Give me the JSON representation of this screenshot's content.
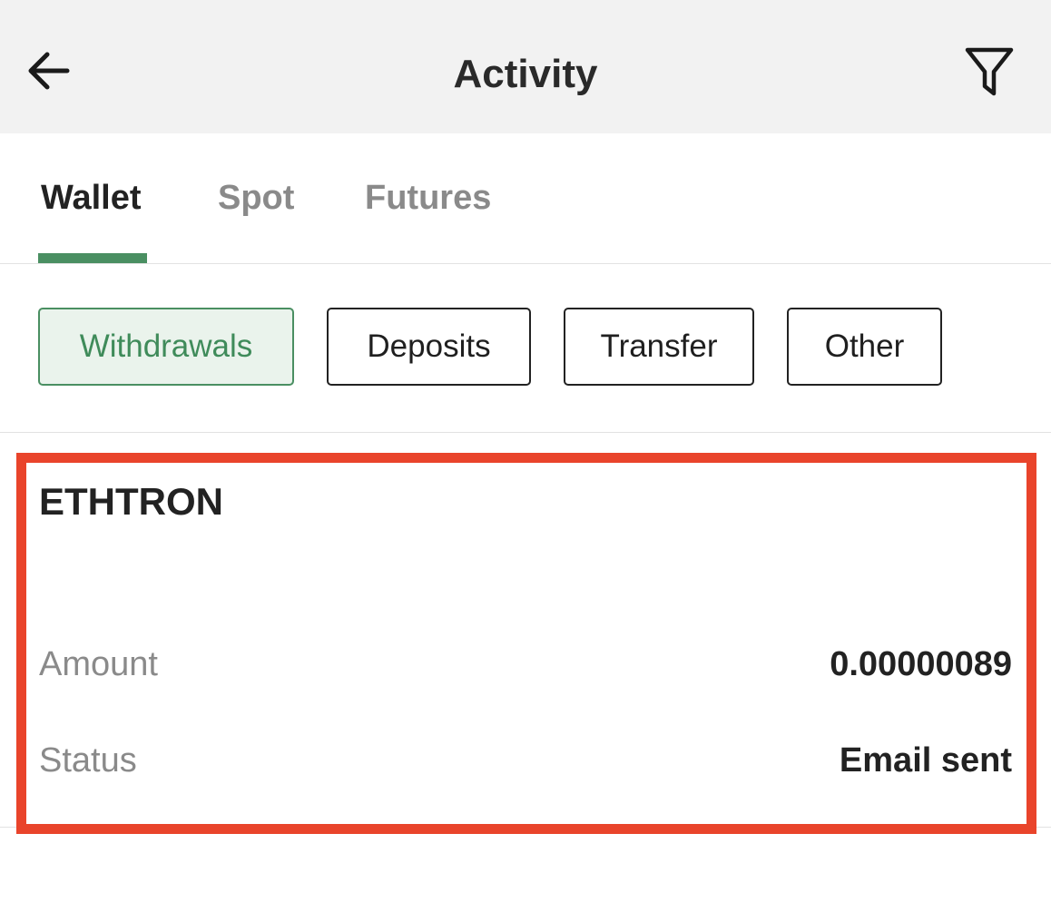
{
  "header": {
    "title": "Activity",
    "back_icon": "arrow-left-icon",
    "filter_icon": "funnel-icon"
  },
  "tabs": [
    {
      "label": "Wallet",
      "active": true
    },
    {
      "label": "Spot",
      "active": false
    },
    {
      "label": "Futures",
      "active": false
    }
  ],
  "filters": [
    {
      "label": "Withdrawals",
      "active": true
    },
    {
      "label": "Deposits",
      "active": false
    },
    {
      "label": "Transfer",
      "active": false
    },
    {
      "label": "Other",
      "active": false
    }
  ],
  "transaction": {
    "coin": "ETHTRON",
    "amount_label": "Amount",
    "amount_value": "0.00000089",
    "status_label": "Status",
    "status_value": "Email sent"
  },
  "colors": {
    "accent": "#4a8f62",
    "highlight": "#e9442b",
    "header_bg": "#f2f2f2"
  }
}
